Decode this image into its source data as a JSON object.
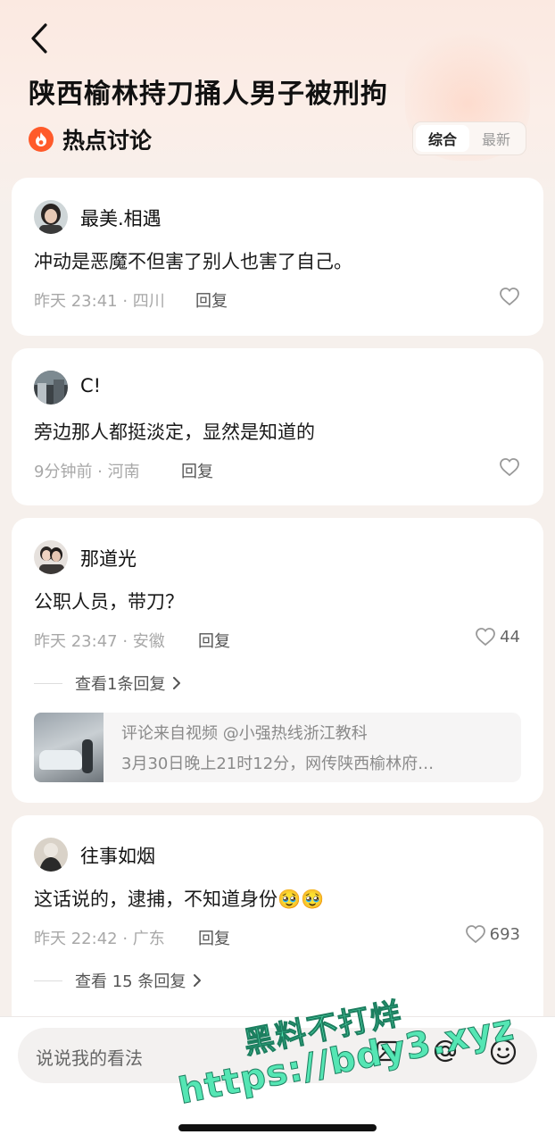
{
  "header": {
    "title": "陕西榆林持刀捅人男子被刑拘",
    "section_title": "热点讨论",
    "sort_options": [
      "综合",
      "最新"
    ]
  },
  "comments": [
    {
      "username": "最美.相遇",
      "content": "冲动是恶魔不但害了别人也害了自己。",
      "meta": "昨天 23:41 · 四川",
      "reply_label": "回复",
      "likes": ""
    },
    {
      "username": "C!",
      "content": "旁边那人都挺淡定，显然是知道的",
      "meta": "9分钟前 · 河南",
      "reply_label": "回复",
      "likes": ""
    },
    {
      "username": "那道光",
      "content": "公职人员，带刀？",
      "meta": "昨天 23:47 · 安徽",
      "reply_label": "回复",
      "likes": "44",
      "view_replies": "查看1条回复",
      "video_ref": {
        "line1": "评论来自视频 @小强热线浙江教科",
        "line2": "3月30日晚上21时12分，网传陕西榆林府…"
      }
    },
    {
      "username": "往事如烟",
      "content": "这话说的，逮捕，不知道身份🥹🥹",
      "meta": "昨天 22:42 · 广东",
      "reply_label": "回复",
      "likes": "693",
      "view_replies": "查看 15 条回复"
    }
  ],
  "bottom_bar": {
    "input_placeholder": "说说我的看法"
  },
  "watermark": {
    "line1": "黑料不打烊",
    "line2": "https://bdy3.xyz"
  },
  "colors": {
    "hot_icon": "#ff5a2a",
    "watermark": "#55e6b4"
  }
}
